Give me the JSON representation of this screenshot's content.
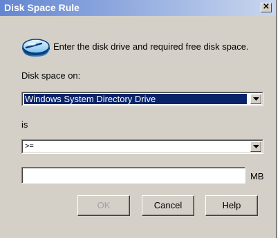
{
  "window": {
    "title": "Disk Space Rule",
    "close_glyph": "×",
    "close_icon": "close-icon"
  },
  "header": {
    "icon": "disk-drive-icon",
    "instruction": "Enter the disk drive and required free disk space."
  },
  "form": {
    "disk_space_label": "Disk space on:",
    "drive_selected": "Windows System Directory Drive",
    "operator_label": "is",
    "operator_selected": ">=",
    "amount_value": "",
    "amount_unit": "MB"
  },
  "buttons": {
    "ok": "OK",
    "ok_enabled": false,
    "cancel": "Cancel",
    "help": "Help"
  },
  "colors": {
    "title_gradient_start": "#6486d2",
    "selection": "#0a246a",
    "dialog_face": "#d4d0c8"
  }
}
